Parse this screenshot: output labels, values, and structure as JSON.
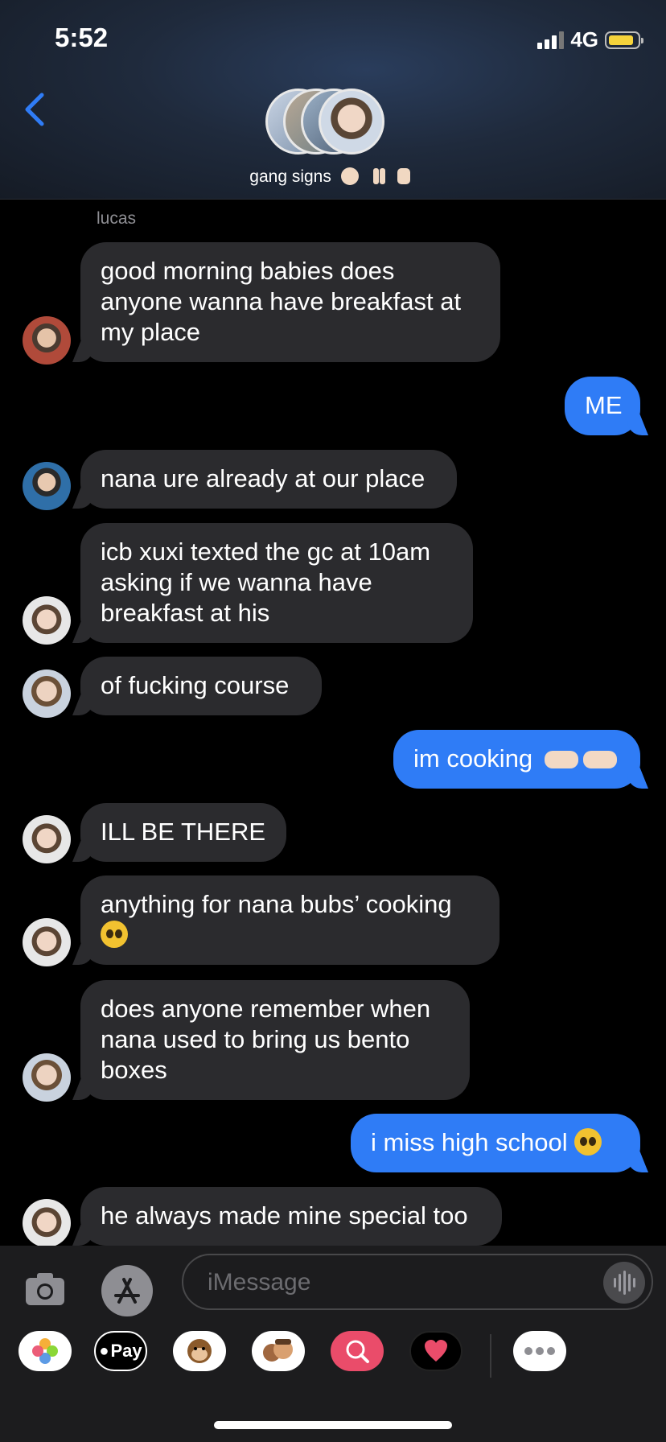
{
  "status": {
    "time": "5:52",
    "network": "4G"
  },
  "header": {
    "title": "gang signs",
    "back_icon": "chevron-left-icon"
  },
  "thread": {
    "sender_label": "lucas",
    "messages": [
      {
        "text": "good morning babies does anyone wanna have breakfast at my place",
        "dir": "in"
      },
      {
        "text": "ME",
        "dir": "out"
      },
      {
        "text": "nana ure already at our place",
        "dir": "in"
      },
      {
        "text": "icb xuxi texted the gc at 10am asking if we wanna have breakfast at his",
        "dir": "in"
      },
      {
        "text": "of fucking course",
        "dir": "in"
      },
      {
        "text": "im cooking",
        "dir": "out"
      },
      {
        "text": "ILL BE THERE",
        "dir": "in"
      },
      {
        "text": "anything for nana bubs’ cooking",
        "dir": "in"
      },
      {
        "text": "does anyone remember when nana used to bring us bento boxes",
        "dir": "in"
      },
      {
        "text": "i miss high school",
        "dir": "out"
      },
      {
        "text": "he always made mine special too",
        "dir": "in"
      }
    ]
  },
  "composer": {
    "placeholder": "iMessage"
  },
  "tray": {
    "applepay_label": "Pay"
  },
  "colors": {
    "outgoing": "#2f7cf6",
    "incoming": "#2b2b2e",
    "accent": "#2f7cf6"
  }
}
